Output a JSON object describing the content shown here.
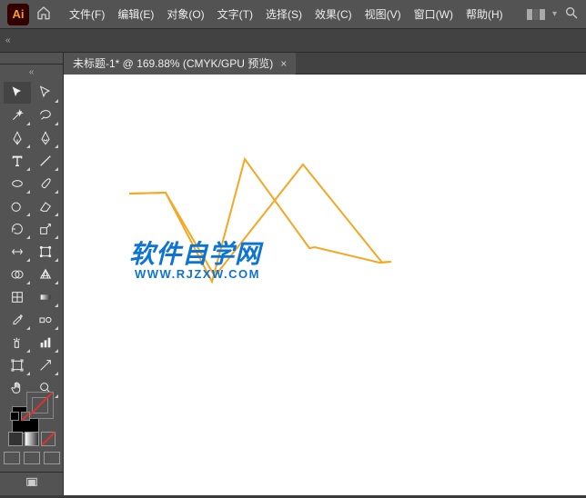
{
  "app": {
    "logo_text": "Ai"
  },
  "menu": {
    "file": "文件(F)",
    "edit": "编辑(E)",
    "object": "对象(O)",
    "text": "文字(T)",
    "select": "选择(S)",
    "effect": "效果(C)",
    "view": "视图(V)",
    "window": "窗口(W)",
    "help": "帮助(H)"
  },
  "tab": {
    "title": "未标题-1* @ 169.88% (CMYK/GPU 预览)",
    "close": "×"
  },
  "watermark": {
    "text": "软件自学网",
    "url": "WWW.RJZXW.COM"
  },
  "chevrons": {
    "down": "▾",
    "double_left": "«",
    "double_right": "»"
  }
}
